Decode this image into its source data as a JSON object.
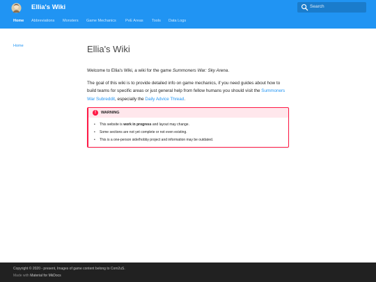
{
  "header": {
    "title": "Ellia's Wiki",
    "logo_icon": "avatar-logo-icon",
    "search_placeholder": "Search"
  },
  "tabs": [
    {
      "label": "Home",
      "active": true
    },
    {
      "label": "Abbreviations",
      "active": false
    },
    {
      "label": "Monsters",
      "active": false
    },
    {
      "label": "Game Mechanics",
      "active": false
    },
    {
      "label": "PvE Areas",
      "active": false
    },
    {
      "label": "Tools",
      "active": false
    },
    {
      "label": "Data Logs",
      "active": false
    }
  ],
  "sidebar": {
    "home_label": "Home"
  },
  "main": {
    "title": "Ellia's Wiki",
    "intro_prefix": "Welcome to Ellia's Wiki, a wiki for the game ",
    "intro_game": "Summoners War: Sky Arena",
    "intro_suffix": ".",
    "goal_text": "The goal of this wiki is to provide detailed info on game mechanics, if you need guides about how to build teams for specific areas or just general help from fellow humans you should visit the ",
    "subreddit_link": "Summoners War Subreddit",
    "goal_middle": ", especially the ",
    "advice_link": "Daily Advice Thread",
    "goal_end": "."
  },
  "warning": {
    "title": "WARNING",
    "icon": "exclamation-icon",
    "items": [
      {
        "prefix": "This website is ",
        "bold": "work in progress",
        "suffix": " and layout may change."
      },
      {
        "text": "Some sections are not yet complete or not even existing."
      },
      {
        "text": "This is a one-person side/hobby project and information may be outdated."
      }
    ]
  },
  "footer": {
    "copyright": "Copyright © 2020 - present, Images of game content belong to Com2uS.",
    "made_with_prefix": "Made with ",
    "made_with_link": "Material for MkDocs"
  },
  "colors": {
    "primary": "#2094f3",
    "warning": "#ff1744",
    "footer": "#212121"
  }
}
